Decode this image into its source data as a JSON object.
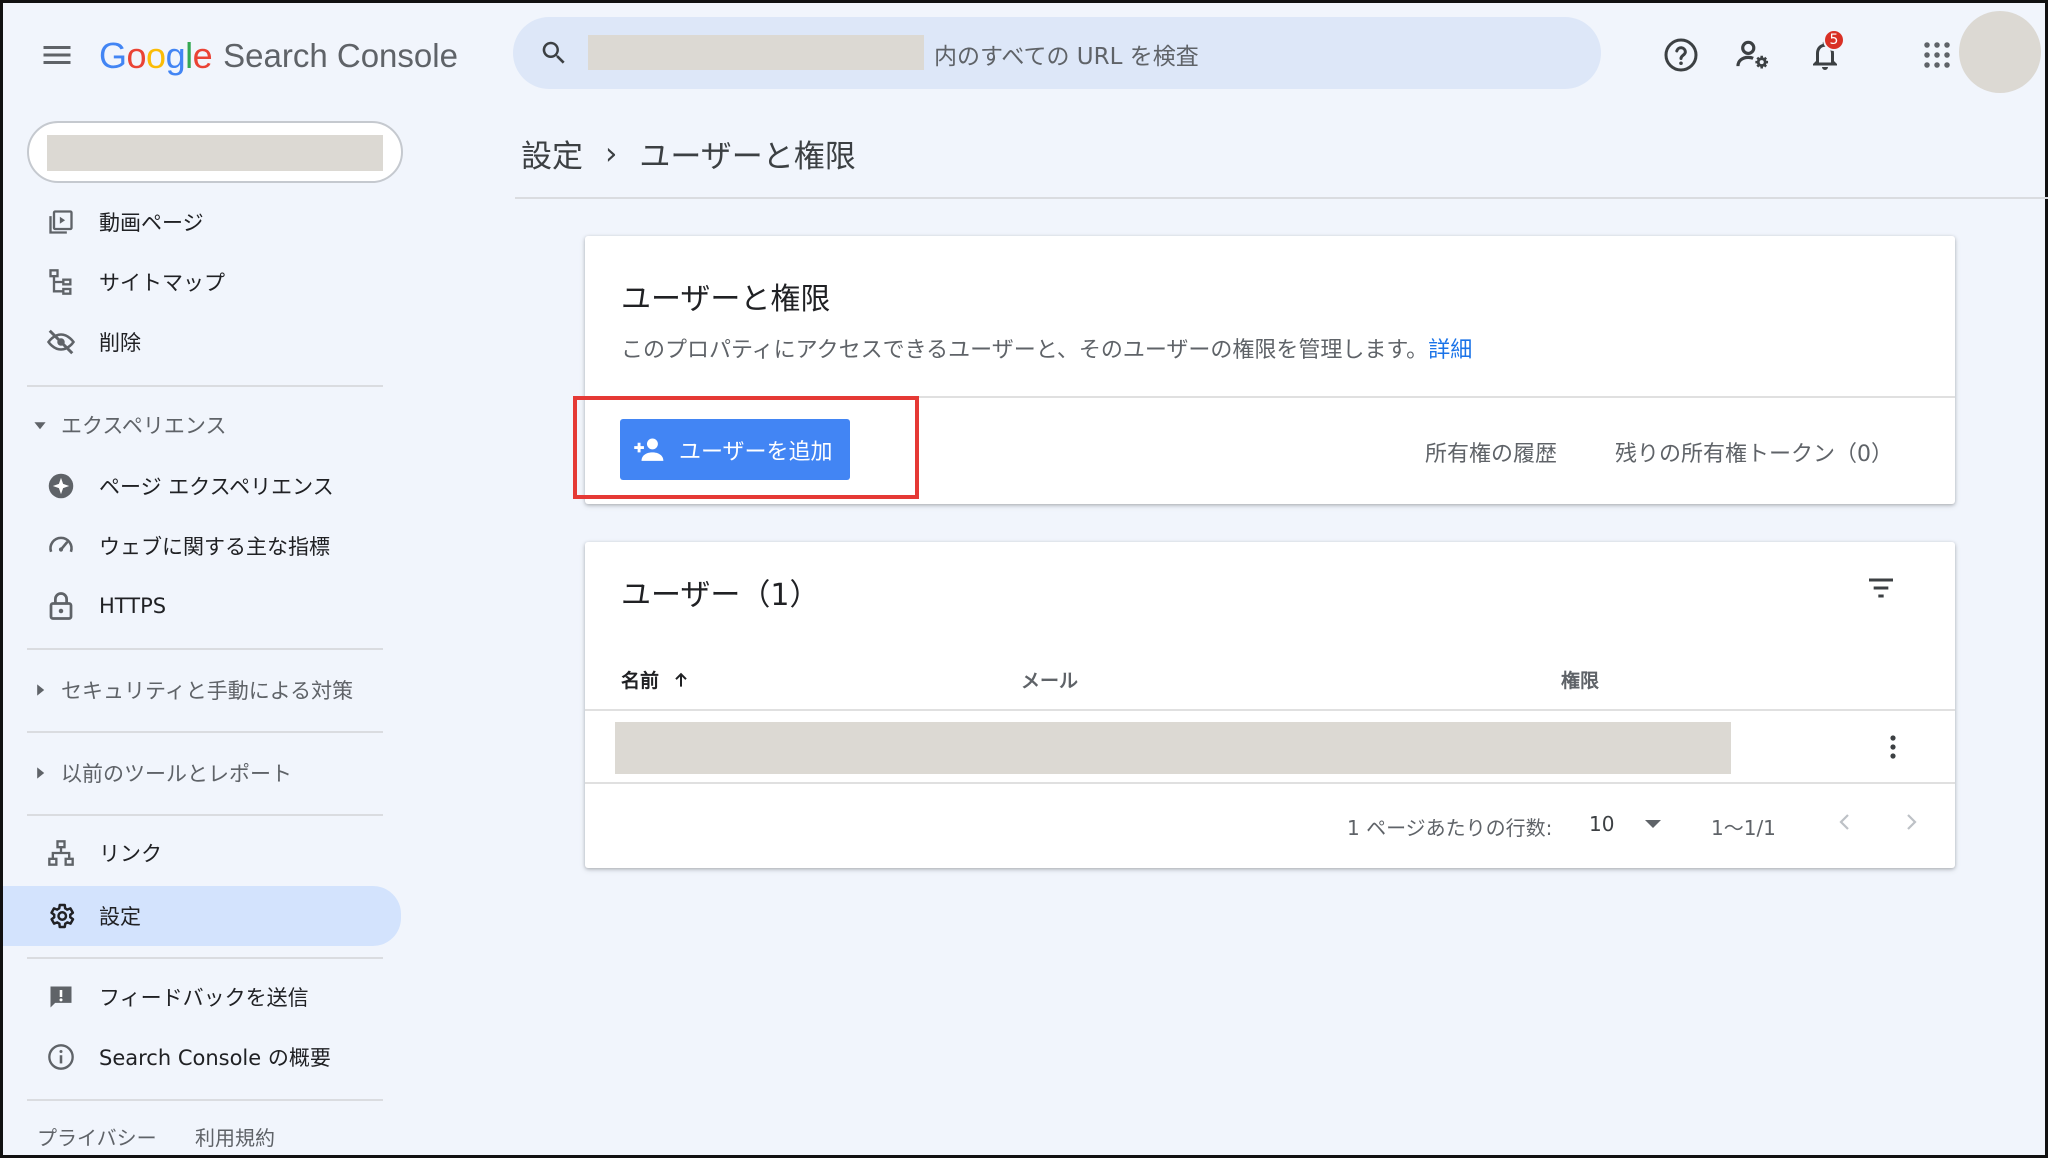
{
  "app": {
    "logo_google": [
      "G",
      "o",
      "o",
      "g",
      "l",
      "e"
    ],
    "logo_colors": [
      "#4285f4",
      "#ea4335",
      "#fbbc05",
      "#4285f4",
      "#34a853",
      "#ea4335"
    ],
    "product_name": "Search Console"
  },
  "search": {
    "placeholder": "内のすべての URL を検査"
  },
  "header": {
    "notifications_count": "5"
  },
  "sidebar": {
    "items_top": [
      {
        "label": "動画ページ",
        "icon": "video-page-icon"
      },
      {
        "label": "サイトマップ",
        "icon": "sitemap-icon"
      },
      {
        "label": "削除",
        "icon": "removal-icon"
      }
    ],
    "section_experience": "エクスペリエンス",
    "items_experience": [
      {
        "label": "ページ エクスペリエンス",
        "icon": "page-experience-icon"
      },
      {
        "label": "ウェブに関する主な指標",
        "icon": "speed-gauge-icon"
      },
      {
        "label": "HTTPS",
        "icon": "lock-icon"
      }
    ],
    "section_security": "セキュリティと手動による対策",
    "section_legacy": "以前のツールとレポート",
    "items_bottom": [
      {
        "label": "リンク",
        "icon": "links-icon"
      },
      {
        "label": "設定",
        "icon": "gear-icon"
      }
    ],
    "items_footer": [
      {
        "label": "フィードバックを送信",
        "icon": "feedback-icon"
      },
      {
        "label": "Search Console の概要",
        "icon": "info-icon"
      }
    ],
    "footer_privacy": "プライバシー",
    "footer_terms": "利用規約"
  },
  "breadcrumb": {
    "parent": "設定",
    "separator": "›",
    "current": "ユーザーと権限"
  },
  "permissions_card": {
    "title": "ユーザーと権限",
    "description": "このプロパティにアクセスできるユーザーと、そのユーザーの権限を管理します。",
    "details_link": "詳細",
    "add_user_label": "ユーザーを追加",
    "ownership_history": "所有権の履歴",
    "ownership_tokens": "残りの所有権トークン（0）"
  },
  "users_card": {
    "title": "ユーザー（1）",
    "columns": {
      "name": "名前",
      "email": "メール",
      "permission": "権限"
    },
    "rows_per_page_label": "1 ページあたりの行数:",
    "rows_per_page_value": "10",
    "range": "1〜1/1"
  },
  "colors": {
    "accent": "#4285f4",
    "highlight": "#e53935",
    "active_nav": "#d3e3fd"
  }
}
